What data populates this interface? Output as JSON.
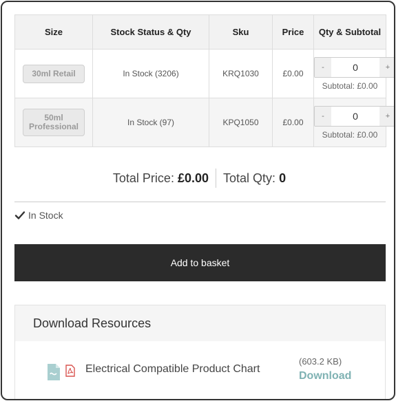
{
  "table": {
    "headers": [
      "Size",
      "Stock Status & Qty",
      "Sku",
      "Price",
      "Qty & Subtotal"
    ],
    "rows": [
      {
        "size": "30ml Retail",
        "stock": "In Stock (3206)",
        "sku": "KRQ1030",
        "price": "£0.00",
        "qty": "0",
        "minus": "-",
        "plus": "+",
        "subtotal": "Subtotal: £0.00"
      },
      {
        "size": "50ml Professional",
        "stock": "In Stock (97)",
        "sku": "KPQ1050",
        "price": "£0.00",
        "qty": "0",
        "minus": "-",
        "plus": "+",
        "subtotal": "Subtotal: £0.00"
      }
    ]
  },
  "totals": {
    "price_label": "Total Price:",
    "price_value": "£0.00",
    "qty_label": "Total Qty:",
    "qty_value": "0"
  },
  "stock_status": "In Stock",
  "add_to_basket": "Add to basket",
  "resources": {
    "title": "Download Resources",
    "items": [
      {
        "name": "Electrical Compatible Product Chart",
        "size": "(603.2 KB)",
        "link": "Download",
        "file_icon": "file-icon",
        "pdf_icon": "pdf-icon"
      }
    ]
  },
  "colors": {
    "button_bg": "#2b2b2b",
    "download_link": "#7fb2b3",
    "pdf_red": "#d9534f",
    "file_icon": "#a9cfd0",
    "header_bg": "#f2f2f2"
  }
}
